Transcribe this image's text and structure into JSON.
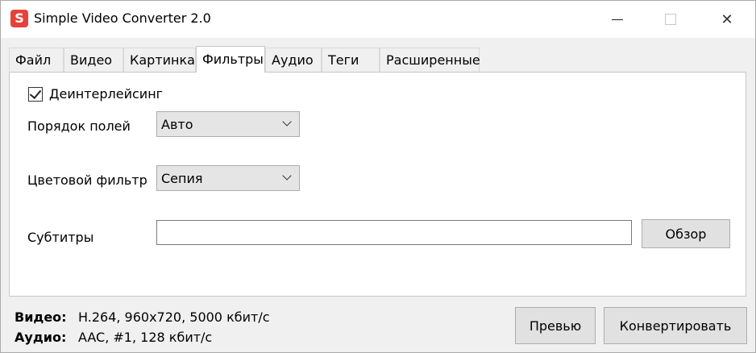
{
  "window": {
    "title": "Simple Video Converter 2.0",
    "icon_letter": "S",
    "accent": "#e8413a"
  },
  "titlebar": {
    "minimize_icon": "minimize-icon",
    "maximize_icon": "maximize-icon",
    "close_icon": "close-icon",
    "close_glyph": "✕"
  },
  "tabs": [
    {
      "label": "Файл",
      "active": false
    },
    {
      "label": "Видео",
      "active": false
    },
    {
      "label": "Картинка",
      "active": false
    },
    {
      "label": "Фильтры",
      "active": true
    },
    {
      "label": "Аудио",
      "active": false
    },
    {
      "label": "Теги",
      "active": false
    },
    {
      "label": "Расширенные",
      "active": false
    }
  ],
  "filters": {
    "deinterlace": {
      "label": "Деинтерлейсинг",
      "checked": true
    },
    "field_order": {
      "label": "Порядок полей",
      "value": "Авто"
    },
    "color_filter": {
      "label": "Цветовой фильтр",
      "value": "Сепия"
    },
    "subtitles": {
      "label": "Субтитры",
      "value": "",
      "browse_label": "Обзор"
    }
  },
  "status": {
    "video_label": "Видео:",
    "video_value": "H.264, 960x720, 5000 кбит/с",
    "audio_label": "Аудио:",
    "audio_value": "AAC, #1, 128 кбит/с"
  },
  "actions": {
    "preview_label": "Превью",
    "convert_label": "Конвертировать"
  }
}
